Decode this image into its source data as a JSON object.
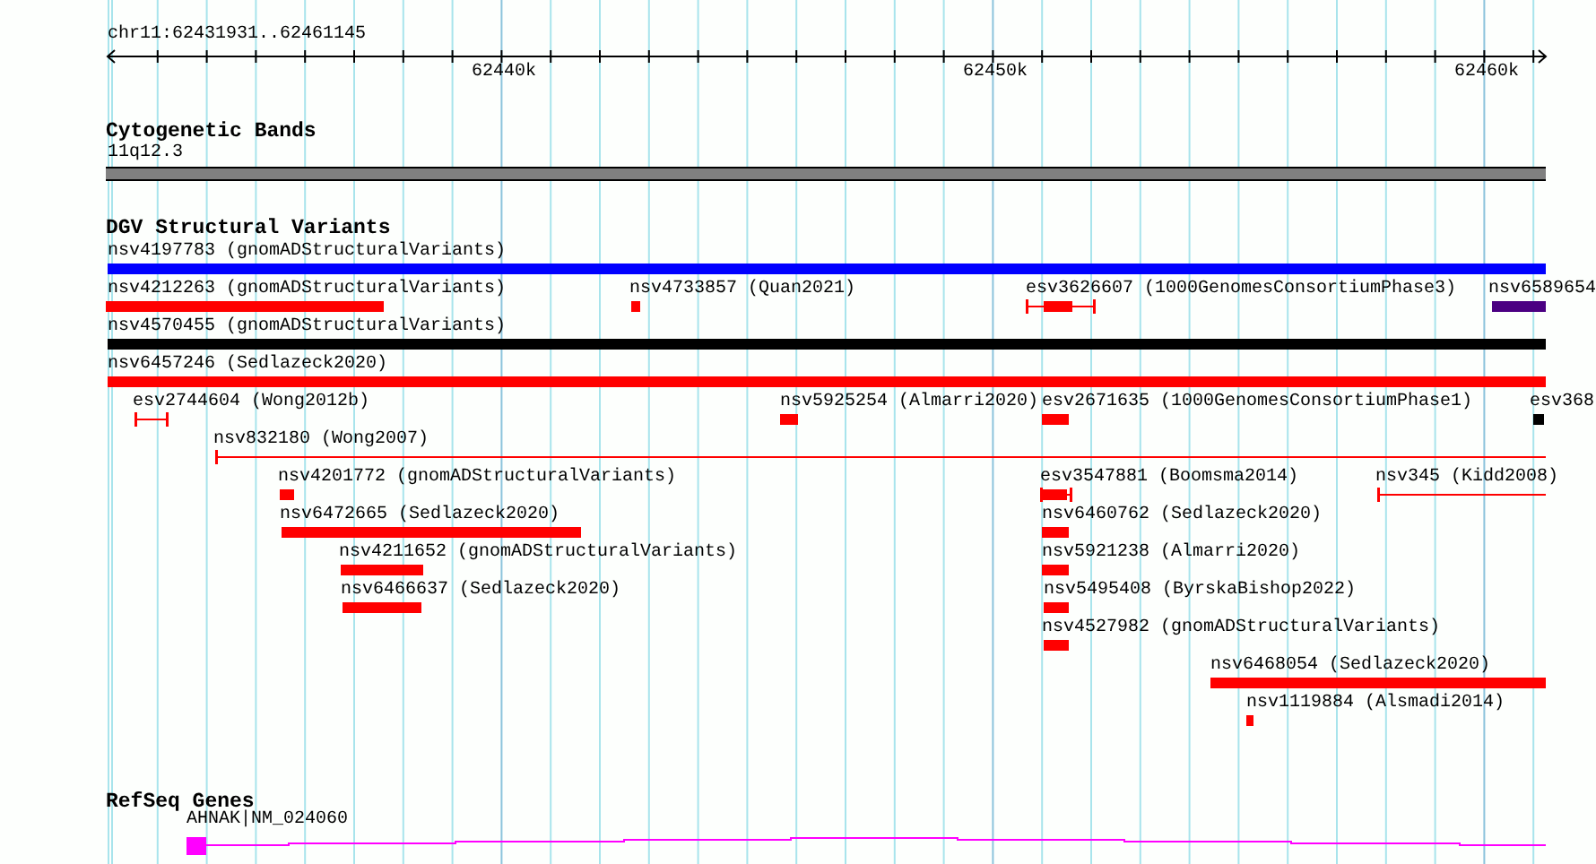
{
  "ruler": {
    "location": "chr11:62431931..62461145",
    "ticks": [
      "62440k",
      "62450k",
      "62460k"
    ]
  },
  "tracks": [
    {
      "title": "Cytogenetic Bands",
      "features": [
        {
          "label": "11q12.3",
          "kind": "band",
          "color": "#808080"
        }
      ]
    },
    {
      "title": "DGV Structural Variants",
      "features": [
        {
          "label": "nsv4197783 (gnomADStructuralVariants)",
          "kind": "bar",
          "color": "#0000ff"
        },
        {
          "label": "nsv4212263 (gnomADStructuralVariants)",
          "kind": "bar",
          "color": "#ff0000"
        },
        {
          "label": "nsv4733857 (Quan2021)",
          "kind": "bar",
          "color": "#ff0000"
        },
        {
          "label": "esv3626607 (1000GenomesConsortiumPhase3)",
          "kind": "capped",
          "color": "#ff0000"
        },
        {
          "label": "nsv6589654",
          "kind": "bar",
          "color": "#4b0082"
        },
        {
          "label": "nsv4570455 (gnomADStructuralVariants)",
          "kind": "bar",
          "color": "#000000"
        },
        {
          "label": "nsv6457246 (Sedlazeck2020)",
          "kind": "bar",
          "color": "#ff0000"
        },
        {
          "label": "esv2744604 (Wong2012b)",
          "kind": "capped",
          "color": "#ff0000"
        },
        {
          "label": "nsv5925254 (Almarri2020)",
          "kind": "bar",
          "color": "#ff0000"
        },
        {
          "label": "esv2671635 (1000GenomesConsortiumPhase1)",
          "kind": "bar",
          "color": "#ff0000"
        },
        {
          "label": "esv368",
          "kind": "bar",
          "color": "#000000"
        },
        {
          "label": "nsv832180 (Wong2007)",
          "kind": "line",
          "color": "#ff0000"
        },
        {
          "label": "nsv4201772 (gnomADStructuralVariants)",
          "kind": "bar",
          "color": "#ff0000"
        },
        {
          "label": "esv3547881 (Boomsma2014)",
          "kind": "capped",
          "color": "#ff0000"
        },
        {
          "label": "nsv345 (Kidd2008)",
          "kind": "line",
          "color": "#ff0000"
        },
        {
          "label": "nsv6472665 (Sedlazeck2020)",
          "kind": "bar",
          "color": "#ff0000"
        },
        {
          "label": "nsv6460762 (Sedlazeck2020)",
          "kind": "bar",
          "color": "#ff0000"
        },
        {
          "label": "nsv4211652 (gnomADStructuralVariants)",
          "kind": "bar",
          "color": "#ff0000"
        },
        {
          "label": "nsv5921238 (Almarri2020)",
          "kind": "bar",
          "color": "#ff0000"
        },
        {
          "label": "nsv6466637 (Sedlazeck2020)",
          "kind": "bar",
          "color": "#ff0000"
        },
        {
          "label": "nsv5495408 (ByrskaBishop2022)",
          "kind": "bar",
          "color": "#ff0000"
        },
        {
          "label": "nsv4527982 (gnomADStructuralVariants)",
          "kind": "bar",
          "color": "#ff0000"
        },
        {
          "label": "nsv6468054 (Sedlazeck2020)",
          "kind": "bar",
          "color": "#ff0000"
        },
        {
          "label": "nsv1119884 (Alsmadi2014)",
          "kind": "bar",
          "color": "#ff0000"
        }
      ]
    },
    {
      "title": "RefSeq Genes",
      "features": [
        {
          "label": "AHNAK|NM_024060",
          "kind": "gene",
          "color": "#ff00ff"
        }
      ]
    }
  ]
}
